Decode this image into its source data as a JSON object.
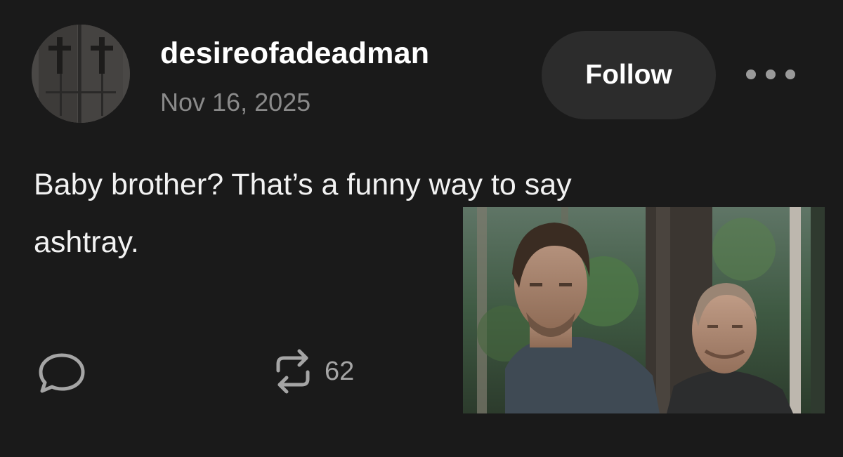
{
  "post": {
    "author": {
      "username": "desireofadeadman",
      "avatar_icon": "avatar-crosses-image"
    },
    "date": "Nov 16, 2025",
    "follow_label": "Follow",
    "more_icon": "more-dots-icon",
    "body_lines": [
      "Baby brother? That’s a funny way to say",
      "ashtray."
    ],
    "image": {
      "description_icon": "photo-two-men-in-forest"
    },
    "actions": {
      "reply_icon": "speech-bubble-icon",
      "reblog_icon": "reblog-arrows-icon",
      "reblog_count": "62"
    }
  },
  "colors": {
    "background": "#1a1a1a",
    "text": "#ffffff",
    "muted": "#8a8a8a",
    "button_bg": "#2c2c2c"
  }
}
